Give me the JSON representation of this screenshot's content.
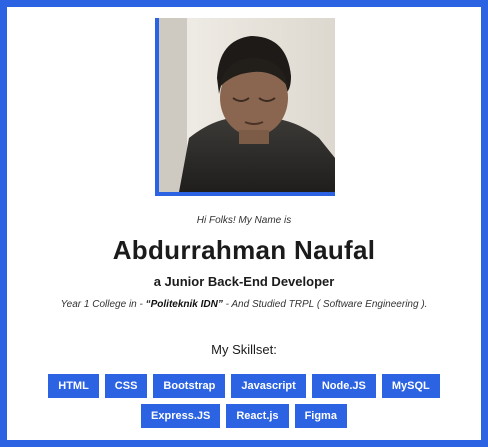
{
  "profile": {
    "greeting": "Hi Folks! My Name is",
    "name": "Abdurrahman Naufal",
    "role": "a Junior Back-End Developer",
    "education_prefix": "Year 1 College in - ",
    "education_school": "“Politeknik IDN”",
    "education_suffix": " - And Studied TRPL ( Software Engineering ).",
    "skills_title": "My Skillset:"
  },
  "skills": [
    "HTML",
    "CSS",
    "Bootstrap",
    "Javascript",
    "Node.JS",
    "MySQL",
    "Express.JS",
    "React.js",
    "Figma"
  ],
  "colors": {
    "accent": "#2b63e3",
    "text": "#1b1b1b",
    "background": "#ffffff"
  }
}
